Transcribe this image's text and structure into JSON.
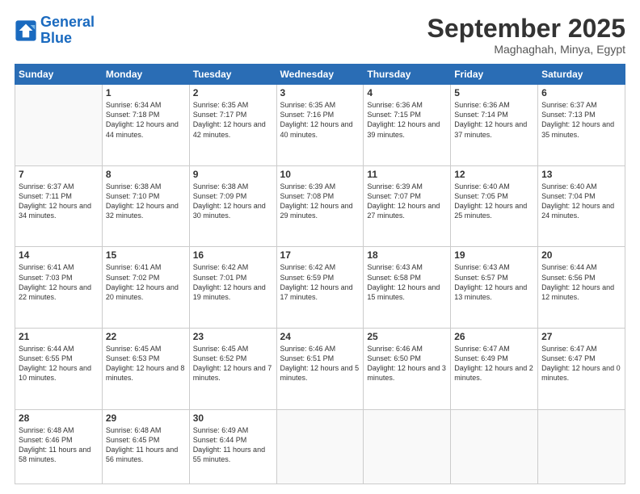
{
  "logo": {
    "line1": "General",
    "line2": "Blue"
  },
  "header": {
    "month": "September 2025",
    "location": "Maghaghah, Minya, Egypt"
  },
  "days": [
    "Sunday",
    "Monday",
    "Tuesday",
    "Wednesday",
    "Thursday",
    "Friday",
    "Saturday"
  ],
  "weeks": [
    [
      {
        "day": "",
        "sunrise": "",
        "sunset": "",
        "daylight": ""
      },
      {
        "day": "1",
        "sunrise": "Sunrise: 6:34 AM",
        "sunset": "Sunset: 7:18 PM",
        "daylight": "Daylight: 12 hours and 44 minutes."
      },
      {
        "day": "2",
        "sunrise": "Sunrise: 6:35 AM",
        "sunset": "Sunset: 7:17 PM",
        "daylight": "Daylight: 12 hours and 42 minutes."
      },
      {
        "day": "3",
        "sunrise": "Sunrise: 6:35 AM",
        "sunset": "Sunset: 7:16 PM",
        "daylight": "Daylight: 12 hours and 40 minutes."
      },
      {
        "day": "4",
        "sunrise": "Sunrise: 6:36 AM",
        "sunset": "Sunset: 7:15 PM",
        "daylight": "Daylight: 12 hours and 39 minutes."
      },
      {
        "day": "5",
        "sunrise": "Sunrise: 6:36 AM",
        "sunset": "Sunset: 7:14 PM",
        "daylight": "Daylight: 12 hours and 37 minutes."
      },
      {
        "day": "6",
        "sunrise": "Sunrise: 6:37 AM",
        "sunset": "Sunset: 7:13 PM",
        "daylight": "Daylight: 12 hours and 35 minutes."
      }
    ],
    [
      {
        "day": "7",
        "sunrise": "Sunrise: 6:37 AM",
        "sunset": "Sunset: 7:11 PM",
        "daylight": "Daylight: 12 hours and 34 minutes."
      },
      {
        "day": "8",
        "sunrise": "Sunrise: 6:38 AM",
        "sunset": "Sunset: 7:10 PM",
        "daylight": "Daylight: 12 hours and 32 minutes."
      },
      {
        "day": "9",
        "sunrise": "Sunrise: 6:38 AM",
        "sunset": "Sunset: 7:09 PM",
        "daylight": "Daylight: 12 hours and 30 minutes."
      },
      {
        "day": "10",
        "sunrise": "Sunrise: 6:39 AM",
        "sunset": "Sunset: 7:08 PM",
        "daylight": "Daylight: 12 hours and 29 minutes."
      },
      {
        "day": "11",
        "sunrise": "Sunrise: 6:39 AM",
        "sunset": "Sunset: 7:07 PM",
        "daylight": "Daylight: 12 hours and 27 minutes."
      },
      {
        "day": "12",
        "sunrise": "Sunrise: 6:40 AM",
        "sunset": "Sunset: 7:05 PM",
        "daylight": "Daylight: 12 hours and 25 minutes."
      },
      {
        "day": "13",
        "sunrise": "Sunrise: 6:40 AM",
        "sunset": "Sunset: 7:04 PM",
        "daylight": "Daylight: 12 hours and 24 minutes."
      }
    ],
    [
      {
        "day": "14",
        "sunrise": "Sunrise: 6:41 AM",
        "sunset": "Sunset: 7:03 PM",
        "daylight": "Daylight: 12 hours and 22 minutes."
      },
      {
        "day": "15",
        "sunrise": "Sunrise: 6:41 AM",
        "sunset": "Sunset: 7:02 PM",
        "daylight": "Daylight: 12 hours and 20 minutes."
      },
      {
        "day": "16",
        "sunrise": "Sunrise: 6:42 AM",
        "sunset": "Sunset: 7:01 PM",
        "daylight": "Daylight: 12 hours and 19 minutes."
      },
      {
        "day": "17",
        "sunrise": "Sunrise: 6:42 AM",
        "sunset": "Sunset: 6:59 PM",
        "daylight": "Daylight: 12 hours and 17 minutes."
      },
      {
        "day": "18",
        "sunrise": "Sunrise: 6:43 AM",
        "sunset": "Sunset: 6:58 PM",
        "daylight": "Daylight: 12 hours and 15 minutes."
      },
      {
        "day": "19",
        "sunrise": "Sunrise: 6:43 AM",
        "sunset": "Sunset: 6:57 PM",
        "daylight": "Daylight: 12 hours and 13 minutes."
      },
      {
        "day": "20",
        "sunrise": "Sunrise: 6:44 AM",
        "sunset": "Sunset: 6:56 PM",
        "daylight": "Daylight: 12 hours and 12 minutes."
      }
    ],
    [
      {
        "day": "21",
        "sunrise": "Sunrise: 6:44 AM",
        "sunset": "Sunset: 6:55 PM",
        "daylight": "Daylight: 12 hours and 10 minutes."
      },
      {
        "day": "22",
        "sunrise": "Sunrise: 6:45 AM",
        "sunset": "Sunset: 6:53 PM",
        "daylight": "Daylight: 12 hours and 8 minutes."
      },
      {
        "day": "23",
        "sunrise": "Sunrise: 6:45 AM",
        "sunset": "Sunset: 6:52 PM",
        "daylight": "Daylight: 12 hours and 7 minutes."
      },
      {
        "day": "24",
        "sunrise": "Sunrise: 6:46 AM",
        "sunset": "Sunset: 6:51 PM",
        "daylight": "Daylight: 12 hours and 5 minutes."
      },
      {
        "day": "25",
        "sunrise": "Sunrise: 6:46 AM",
        "sunset": "Sunset: 6:50 PM",
        "daylight": "Daylight: 12 hours and 3 minutes."
      },
      {
        "day": "26",
        "sunrise": "Sunrise: 6:47 AM",
        "sunset": "Sunset: 6:49 PM",
        "daylight": "Daylight: 12 hours and 2 minutes."
      },
      {
        "day": "27",
        "sunrise": "Sunrise: 6:47 AM",
        "sunset": "Sunset: 6:47 PM",
        "daylight": "Daylight: 12 hours and 0 minutes."
      }
    ],
    [
      {
        "day": "28",
        "sunrise": "Sunrise: 6:48 AM",
        "sunset": "Sunset: 6:46 PM",
        "daylight": "Daylight: 11 hours and 58 minutes."
      },
      {
        "day": "29",
        "sunrise": "Sunrise: 6:48 AM",
        "sunset": "Sunset: 6:45 PM",
        "daylight": "Daylight: 11 hours and 56 minutes."
      },
      {
        "day": "30",
        "sunrise": "Sunrise: 6:49 AM",
        "sunset": "Sunset: 6:44 PM",
        "daylight": "Daylight: 11 hours and 55 minutes."
      },
      {
        "day": "",
        "sunrise": "",
        "sunset": "",
        "daylight": ""
      },
      {
        "day": "",
        "sunrise": "",
        "sunset": "",
        "daylight": ""
      },
      {
        "day": "",
        "sunrise": "",
        "sunset": "",
        "daylight": ""
      },
      {
        "day": "",
        "sunrise": "",
        "sunset": "",
        "daylight": ""
      }
    ]
  ]
}
